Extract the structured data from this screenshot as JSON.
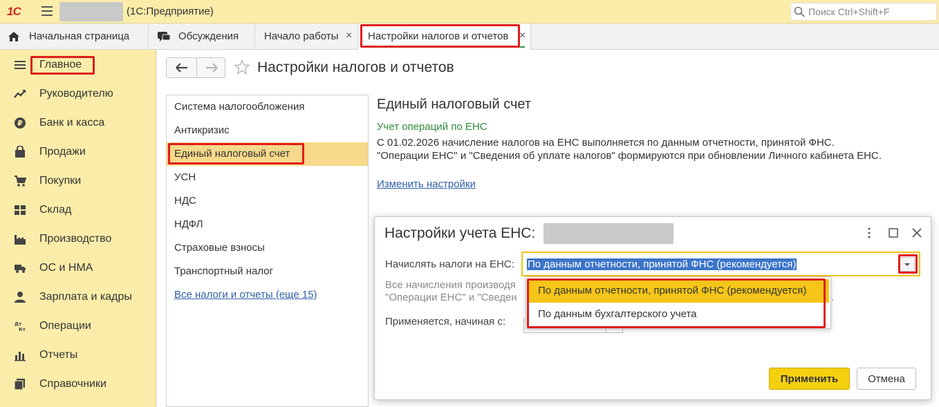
{
  "app": {
    "title": "(1С:Предприятие)",
    "logo": "1С"
  },
  "search": {
    "placeholder": "Поиск Ctrl+Shift+F"
  },
  "tabs": [
    {
      "label": "Начальная страница",
      "icon": "home-icon"
    },
    {
      "label": "Обсуждения",
      "icon": "chat-icon"
    },
    {
      "label": "Начало работы",
      "close": "×"
    },
    {
      "label": "Настройки налогов и отчетов",
      "close": "×",
      "active": true
    }
  ],
  "sidebar": {
    "items": [
      {
        "label": "Главное",
        "icon": "menu-icon"
      },
      {
        "label": "Руководителю",
        "icon": "trend-icon"
      },
      {
        "label": "Банк и касса",
        "icon": "ruble-icon"
      },
      {
        "label": "Продажи",
        "icon": "bag-icon"
      },
      {
        "label": "Покупки",
        "icon": "cart-icon"
      },
      {
        "label": "Склад",
        "icon": "warehouse-icon"
      },
      {
        "label": "Производство",
        "icon": "factory-icon"
      },
      {
        "label": "ОС и НМА",
        "icon": "truck-icon"
      },
      {
        "label": "Зарплата и кадры",
        "icon": "person-icon"
      },
      {
        "label": "Операции",
        "icon": "dt-kt-icon"
      },
      {
        "label": "Отчеты",
        "icon": "bar-chart-icon"
      },
      {
        "label": "Справочники",
        "icon": "books-icon"
      }
    ]
  },
  "page": {
    "title": "Настройки налогов и отчетов"
  },
  "tax_list": {
    "items": [
      "Система налогообложения",
      "Антикризис",
      "Единый налоговый счет",
      "УСН",
      "НДС",
      "НДФЛ",
      "Страховые взносы",
      "Транспортный налог"
    ],
    "more_link": "Все налоги и отчеты (еще 15)"
  },
  "ens": {
    "title": "Единый налоговый счет",
    "subtitle": "Учет операций по ЕНС",
    "line1": "С 01.02.2026 начисление налогов на ЕНС выполняется по данным отчетности, принятой ФНС.",
    "line2": "\"Операции ЕНС\" и \"Сведения об уплате налогов\" формируются при обновлении Личного кабинета ЕНС.",
    "change_link": "Изменить настройки"
  },
  "dialog": {
    "title": "Настройки учета ЕНС:",
    "field_label": "Начислять налоги на ЕНС:",
    "selected_value": "По данным отчетности, принятой ФНС (рекомендуется)",
    "hint_line1": "Все начисления производя",
    "hint_line2": "\"Операции ЕНС\" и \"Сведен",
    "hint_tail": ".",
    "date_label": "Применяется, начиная с:",
    "options": [
      "По данным отчетности, принятой ФНС (рекомендуется)",
      "По данным бухгалтерского учета"
    ],
    "apply": "Применить",
    "cancel": "Отмена"
  },
  "colors": {
    "accent": "#f5d00f",
    "sidebar": "#fbeda9",
    "highlight": "#e01b1b",
    "link": "#2f5ea8",
    "green": "#2e8b3a"
  }
}
